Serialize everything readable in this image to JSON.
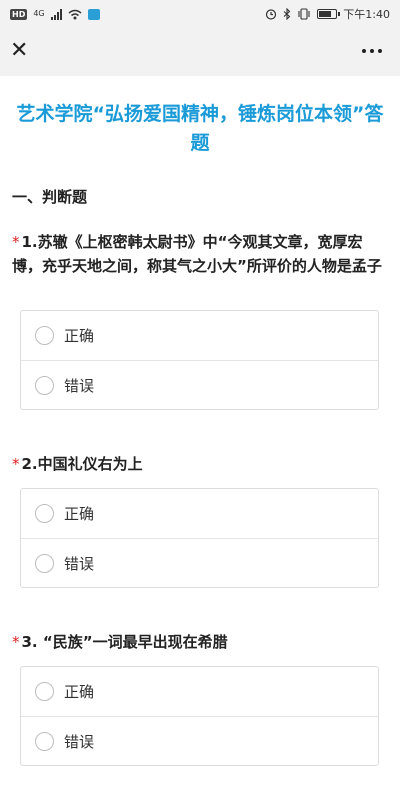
{
  "status_bar": {
    "hd_badge": "HD",
    "network": "4G",
    "time": "下午1:40",
    "battery_level": 0.8,
    "icons": [
      "hd-icon",
      "signal-icon",
      "wifi-icon",
      "wechat-icon",
      "alarm-icon",
      "bluetooth-icon",
      "vibrate-icon",
      "battery-icon"
    ]
  },
  "nav": {
    "close_glyph": "✕",
    "more_icon": "more-dots-icon"
  },
  "page": {
    "title": "艺术学院“弘扬爱国精神，锤炼岗位本领”答题",
    "section_title": "一、判断题"
  },
  "questions": [
    {
      "required_mark": "*",
      "text": "1.苏辙《上枢密韩太尉书》中“今观其文章，宽厚宏博，充乎天地之间，称其气之小大”所评价的人物是孟子",
      "options": [
        "正确",
        "错误"
      ]
    },
    {
      "required_mark": "*",
      "text": "2.中国礼仪右为上",
      "options": [
        "正确",
        "错误"
      ]
    },
    {
      "required_mark": "*",
      "text": "3. “民族”一词最早出现在希腊",
      "options": [
        "正确",
        "错误"
      ]
    }
  ],
  "colors": {
    "title": "#1a9bd7",
    "required": "#e02020",
    "bar_bg": "#f2f2f2"
  }
}
